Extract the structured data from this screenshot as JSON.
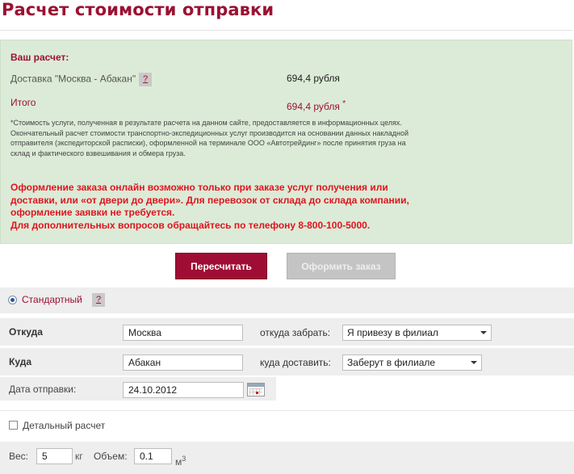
{
  "page": {
    "title": "Расчет стоимости отправки"
  },
  "result": {
    "heading": "Ваш расчет:",
    "delivery_label": "Доставка \"Москва - Абакан\"",
    "delivery_help": "?",
    "delivery_value": "694,4 рубля",
    "total_label": "Итого",
    "total_value": "694,4 рубля",
    "total_mark": "*",
    "disclaimer": "*Стоимость услуги, полученная в результате расчета на данном сайте, предоставляется в информационных целях. Окончательный расчет стоимости транспортно-экспедиционных услуг производится на основании данных накладной отправителя (экспедиторской расписки), оформленной на терминале ООО «Автотрейдинг» после принятия груза на склад и фактического взвешивания и обмера груза.",
    "warning_line1": "Оформление заказа онлайн возможно только при заказе услуг получения или доставки, или «от двери до двери». Для перевозок от склада до склада компании, оформление заявки не требуется.",
    "warning_line2": "Для дополнительных вопросов обращайтесь по телефону 8-800-100-5000."
  },
  "buttons": {
    "recalc": "Пересчитать",
    "order": "Оформить заказ"
  },
  "tariff": {
    "label": "Стандартный",
    "help": "?",
    "selected": true
  },
  "form": {
    "from_label": "Откуда",
    "from_value": "Москва",
    "pickup_label": "откуда забрать:",
    "pickup_value": "Я привезу в филиал",
    "to_label": "Куда",
    "to_value": "Абакан",
    "delivery_label": "куда доставить:",
    "delivery_value": "Заберут в филиале",
    "date_label": "Дата отправки:",
    "date_value": "24.10.2012",
    "detailed_label": "Детальный расчет",
    "detailed_checked": false,
    "weight_label": "Вес:",
    "weight_value": "5",
    "weight_unit": "кг",
    "volume_label": "Объем:",
    "volume_value": "0.1",
    "volume_unit": "м",
    "volume_unit_sup": "3"
  },
  "colors": {
    "brand": "#9b1133",
    "warning": "#e0141e",
    "panel_bg": "#dcebd7",
    "band_bg": "#eeeeee"
  }
}
